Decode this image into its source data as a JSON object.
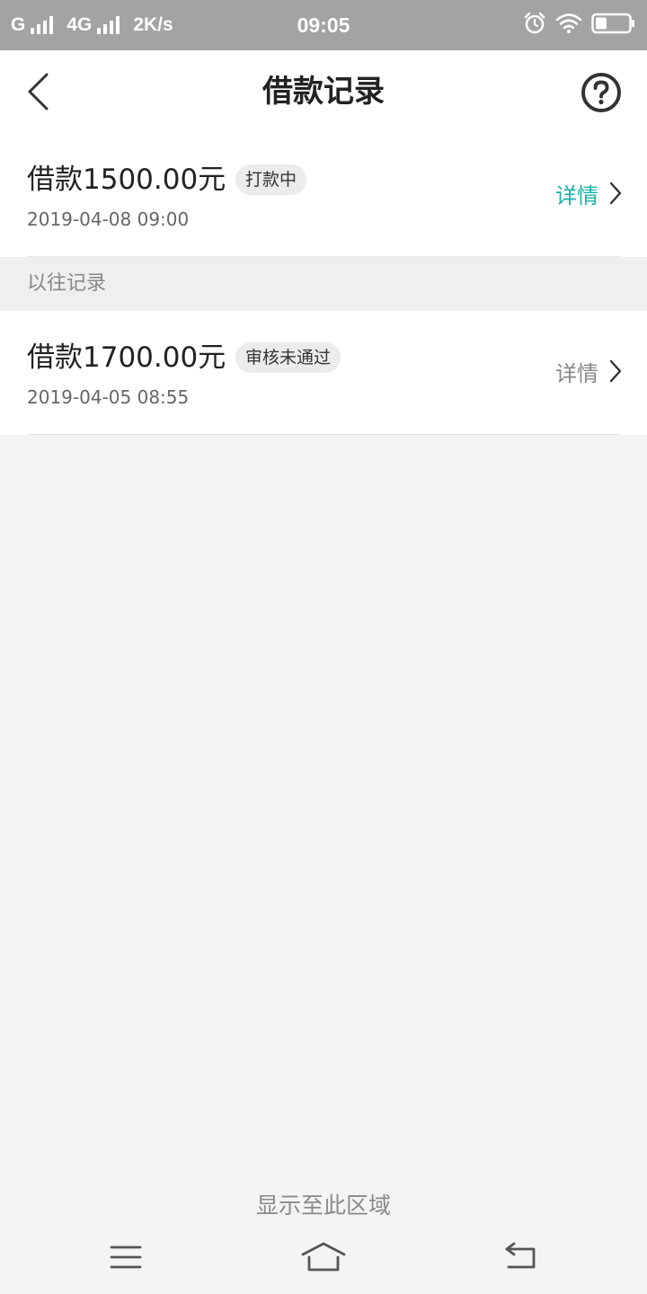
{
  "status_bar": {
    "carrier_1": "G",
    "carrier_2": "4G",
    "speed": "2K/s",
    "time": "09:05"
  },
  "header": {
    "title": "借款记录"
  },
  "current_record": {
    "amount": "借款1500.00元",
    "status": "打款中",
    "date": "2019-04-08 09:00",
    "details_label": "详情",
    "details_color": "#19b3a9"
  },
  "past_section": {
    "title": "以往记录",
    "records": [
      {
        "amount": "借款1700.00元",
        "status": "审核未通过",
        "date": "2019-04-05 08:55",
        "details_label": "详情"
      }
    ]
  },
  "footer": {
    "note": "显示至此区域"
  },
  "icons": {
    "back": "chevron-left-icon",
    "help": "question-circle-icon",
    "details_arrow": "chevron-right-icon",
    "alarm": "alarm-icon",
    "wifi": "wifi-icon",
    "battery": "battery-icon",
    "nav_menu": "menu-icon",
    "nav_home": "home-icon",
    "nav_back": "back-icon"
  }
}
